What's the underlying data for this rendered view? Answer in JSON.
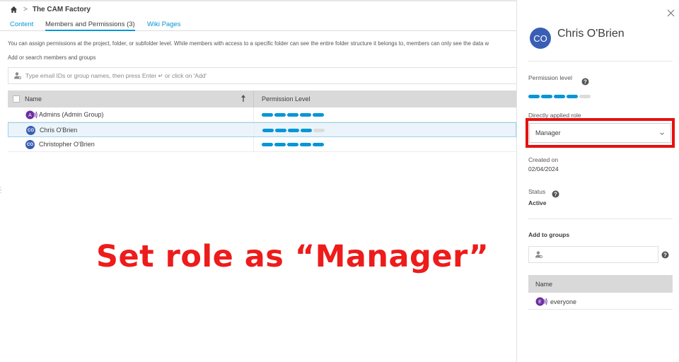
{
  "breadcrumb": {
    "project": "The CAM Factory",
    "home_icon": "home-icon"
  },
  "tabs": [
    {
      "label": "Content",
      "active": false
    },
    {
      "label": "Members and Permissions (3)",
      "active": true
    },
    {
      "label": "Wiki Pages",
      "active": false
    }
  ],
  "info_text": "You can assign permissions at the project, folder, or subfolder level. While members with access to a specific folder can see the entire folder structure it belongs to, members can only see the data w",
  "add_label": "Add or search members and groups",
  "search": {
    "placeholder": "Type email IDs or group names, then press Enter ↵ or click on 'Add'"
  },
  "table": {
    "headers": {
      "name": "Name",
      "permission": "Permission Level"
    },
    "rows": [
      {
        "name": "Admins (Admin Group)",
        "avatar": "A",
        "is_group": true,
        "level": 5,
        "selected": false
      },
      {
        "name": "Chris O'Brien",
        "avatar": "CO",
        "is_group": false,
        "level": 4,
        "selected": true
      },
      {
        "name": "Christopher O'Brien",
        "avatar": "CO",
        "is_group": false,
        "level": 5,
        "selected": false
      }
    ]
  },
  "annotation": "Set role as “Manager”",
  "panel": {
    "avatar": "CO",
    "user_name": "Chris O'Brien",
    "permission_label": "Permission level",
    "permission_level": 4,
    "permission_max": 5,
    "role_label": "Directly applied role",
    "role_value": "Manager",
    "created_label": "Created on",
    "created_value": "02/04/2024",
    "status_label": "Status",
    "status_value": "Active",
    "add_groups_label": "Add to groups",
    "groups_header": "Name",
    "groups": [
      {
        "name": "everyone",
        "avatar": "E"
      }
    ]
  },
  "colors": {
    "accent": "#0696d7",
    "avatar": "#3a5eb5",
    "group_avatar": "#6a2ea0",
    "annotation": "#ee1b1b"
  }
}
